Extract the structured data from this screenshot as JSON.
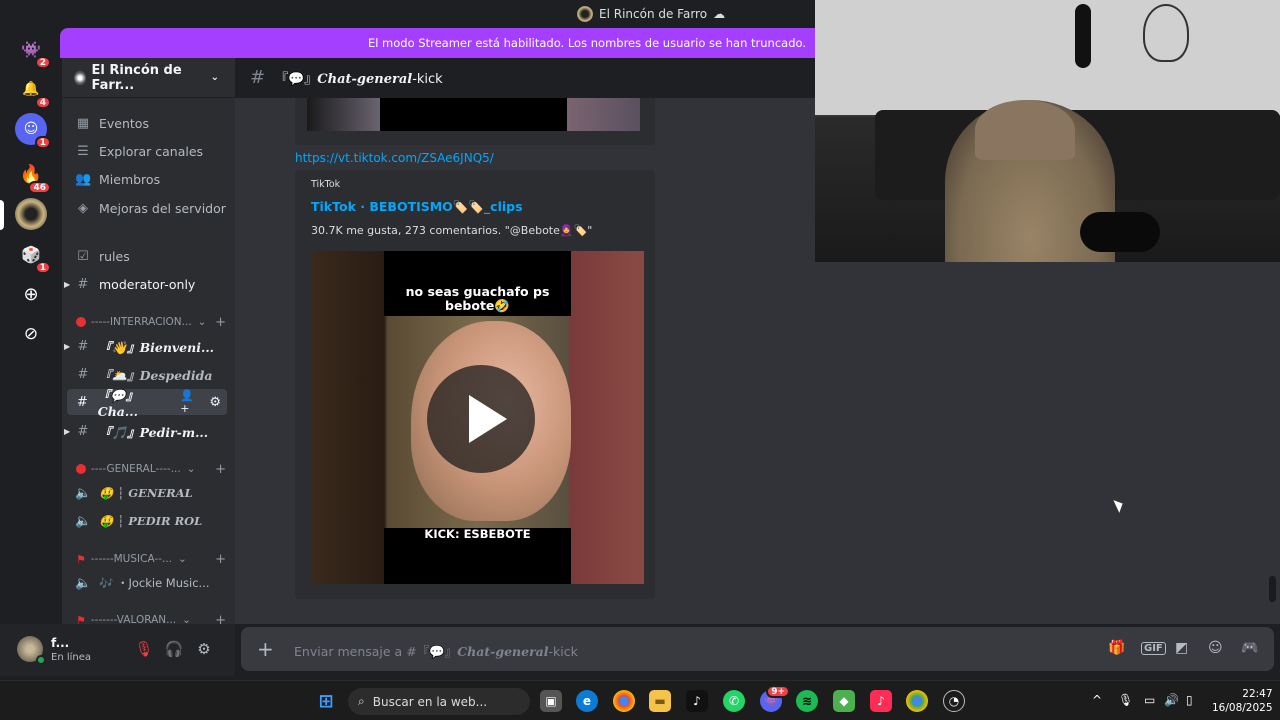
{
  "window": {
    "title": "El Rincón de Farro"
  },
  "banner": {
    "text": "El modo Streamer está habilitado. Los nombres de usuario se han truncado."
  },
  "server_rail": {
    "badges": [
      "2",
      "4",
      "1",
      "46",
      "1"
    ]
  },
  "server": {
    "name": "El Rincón de Farr..."
  },
  "nav": {
    "events": "Eventos",
    "explore": "Explorar canales",
    "members": "Miembros",
    "boosts": "Mejoras del servidor",
    "rules": "rules",
    "moderator": "moderator-only"
  },
  "categories": {
    "interacciones": "-----INTERRACION...",
    "general": "----GENERAL----...",
    "musica": "------MUSICA--...",
    "valorant": "-------VALORAN..."
  },
  "channels": {
    "bienvenida": "『👋』Bienveni...",
    "despedida": "『🌥️』Despedida",
    "chat": "『💬』Cha...",
    "pedir": "『🎵』Pedir-m...",
    "general_voice": "🤑 ┆ GENERAL",
    "pedir_rol": "🤑 ┆ PEDIR ROL",
    "jockie": "🎶 ・Jockie Music..."
  },
  "header": {
    "channel_prefix": "『💬』",
    "channel_italic": "Chat-general",
    "channel_suffix": "-kick"
  },
  "message": {
    "link": "https://vt.tiktok.com/ZSAe6JNQ5/",
    "embed_provider": "TikTok",
    "embed_title": "TikTok · BEBOTISMO🏷️🏷️_clips",
    "embed_desc": "30.7K me gusta, 273 comentarios. \"@Bebote🧕🏷️\"",
    "video_caption_top": "no seas guachafo ps bebote🤣",
    "video_caption_bottom": "KICK: ESBEBOTE"
  },
  "composer": {
    "placeholder_prefix": "Enviar mensaje a #『💬』",
    "placeholder_italic": "Chat-general",
    "placeholder_suffix": "-kick"
  },
  "user": {
    "name": "f...",
    "status": "En línea"
  },
  "taskbar": {
    "search_placeholder": "Buscar en la web...",
    "discord_badge": "9+",
    "time": "22:47",
    "date": "16/08/2025"
  },
  "colors": {
    "streamer_banner": "#a53fff",
    "link": "#00a8fc",
    "notif": "#f23f43",
    "online": "#23a55a"
  }
}
